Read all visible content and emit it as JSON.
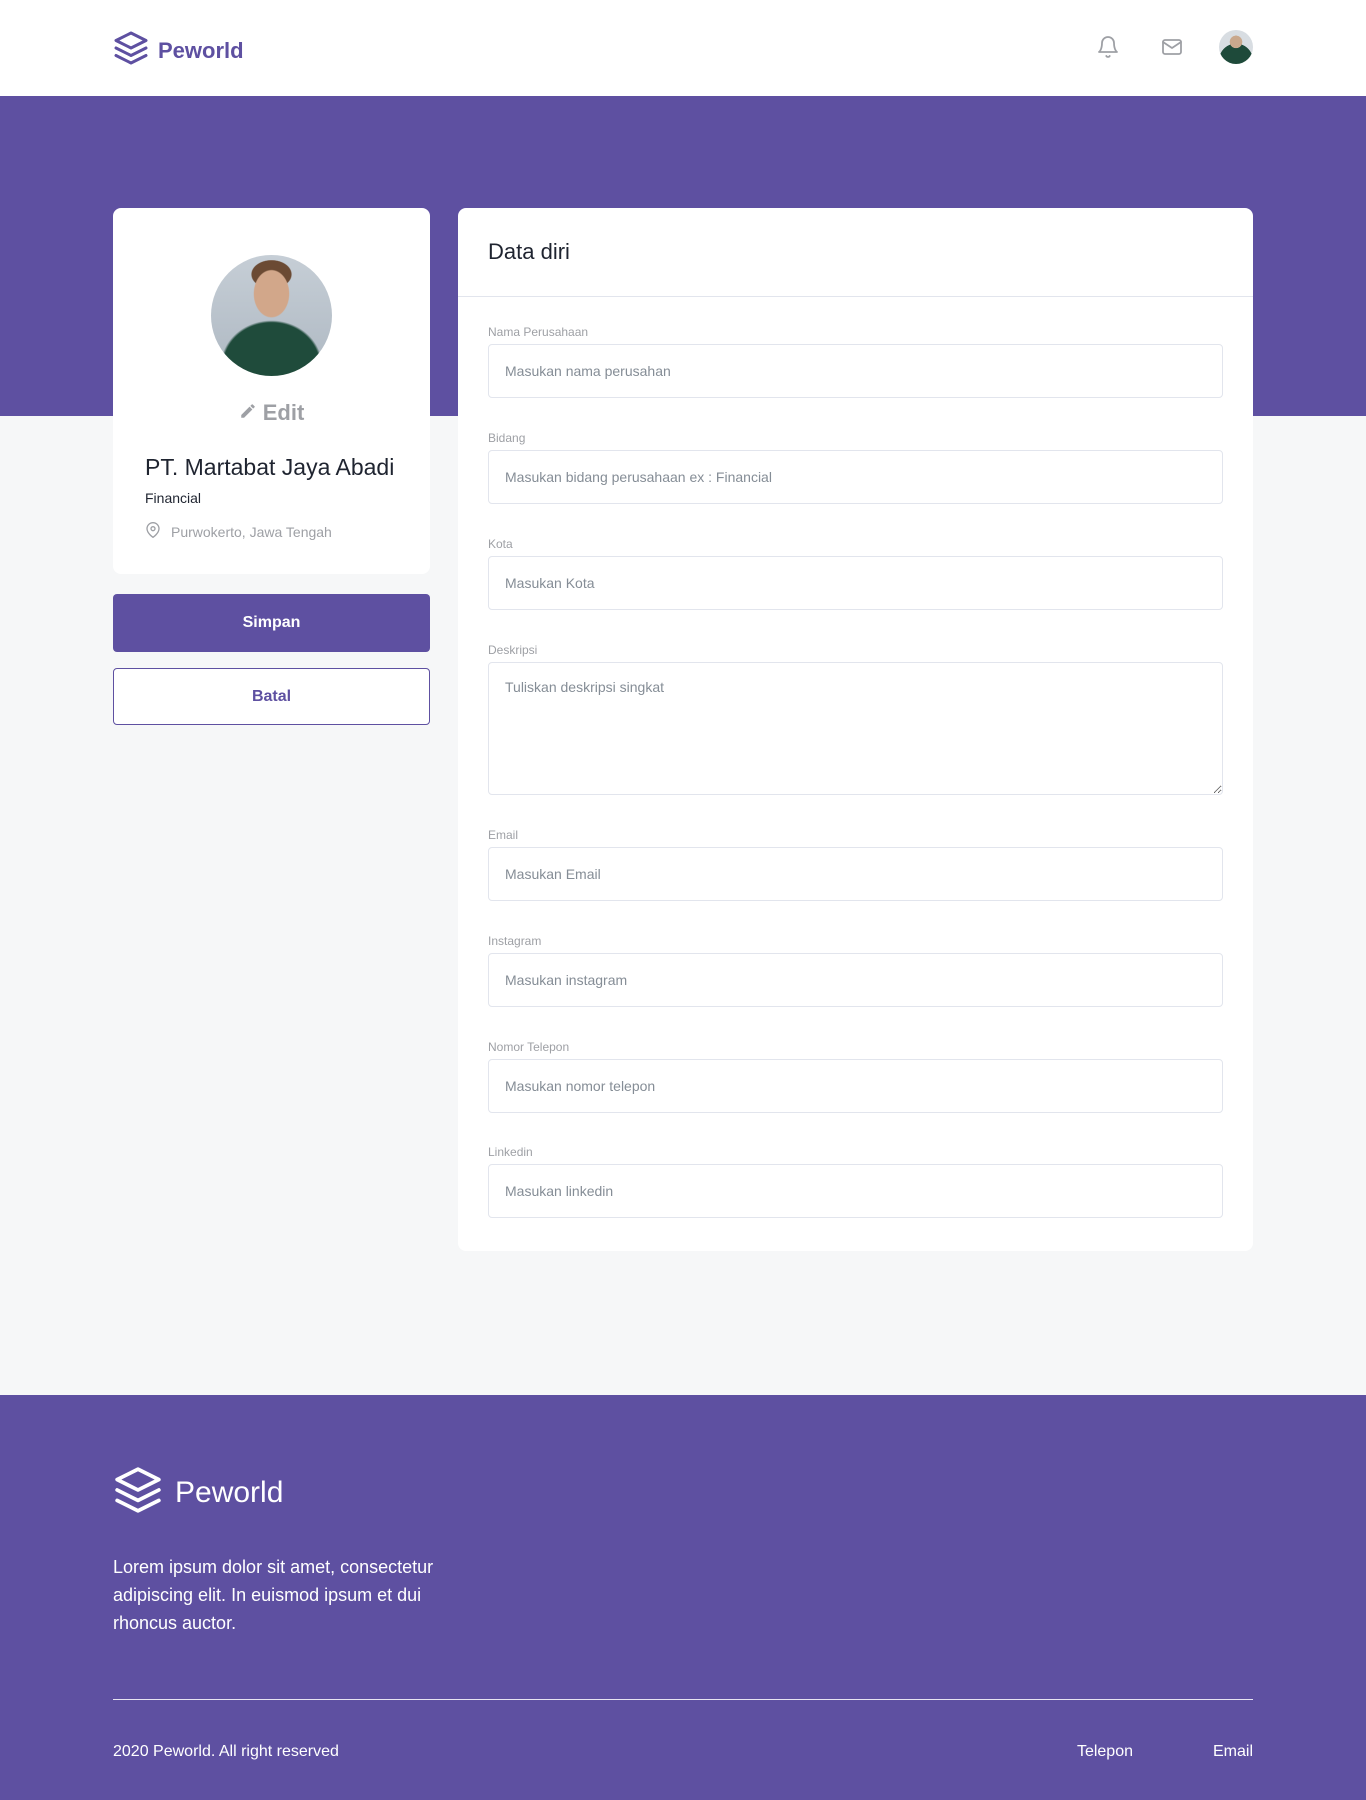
{
  "navbar": {
    "brand": "Peworld",
    "icons": [
      "bell-icon",
      "mail-icon"
    ],
    "avatar": "user-avatar"
  },
  "colors": {
    "primary": "#5e50a1",
    "background": "#f6f7f8",
    "muted_text": "#9ea0a5",
    "border": "#e2e5ed"
  },
  "profile": {
    "edit_label": "Edit",
    "company_name": "PT. Martabat Jaya Abadi",
    "field": "Financial",
    "location": "Purwokerto, Jawa Tengah",
    "save_label": "Simpan",
    "cancel_label": "Batal"
  },
  "form": {
    "title": "Data diri",
    "fields": [
      {
        "label": "Nama Perusahaan",
        "placeholder": "Masukan nama perusahan",
        "value": ""
      },
      {
        "label": "Bidang",
        "placeholder": "Masukan bidang perusahaan ex : Financial",
        "value": ""
      },
      {
        "label": "Kota",
        "placeholder": "Masukan Kota",
        "value": ""
      },
      {
        "label": "Deskripsi",
        "placeholder": "Tuliskan deskripsi singkat",
        "value": ""
      },
      {
        "label": "Email",
        "placeholder": "Masukan Email",
        "value": ""
      },
      {
        "label": "Instagram",
        "placeholder": "Masukan instagram",
        "value": ""
      },
      {
        "label": "Nomor Telepon",
        "placeholder": "Masukan nomor telepon",
        "value": ""
      },
      {
        "label": "Linkedin",
        "placeholder": "Masukan linkedin",
        "value": ""
      }
    ]
  },
  "footer": {
    "brand": "Peworld",
    "description": "Lorem ipsum dolor sit amet, consectetur adipiscing elit. In euismod ipsum et dui rhoncus auctor.",
    "copyright": "2020 Peworld. All right reserved",
    "links": [
      "Telepon",
      "Email"
    ]
  }
}
